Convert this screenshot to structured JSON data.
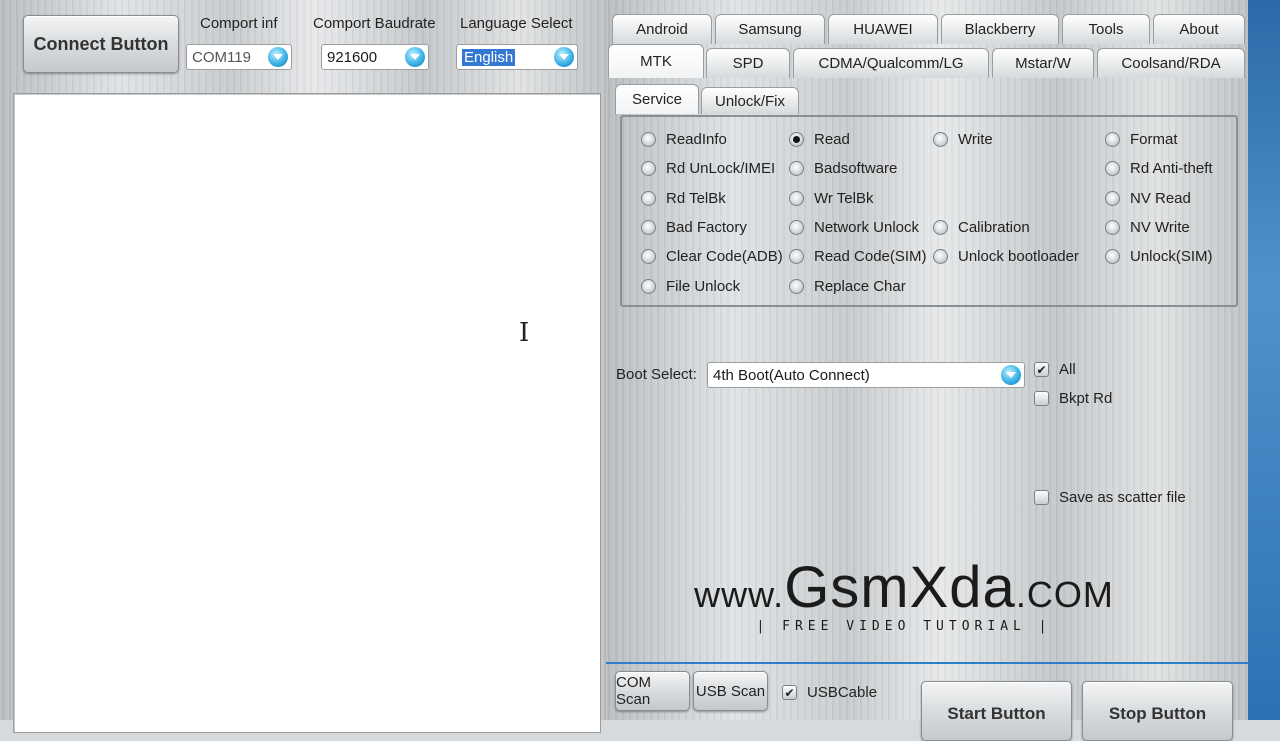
{
  "top": {
    "connect_label": "Connect Button",
    "comport_label": "Comport inf",
    "comport_value": "COM119",
    "baud_label": "Comport Baudrate",
    "baud_value": "921600",
    "lang_label": "Language Select",
    "lang_value": "English"
  },
  "brand_tabs": [
    "Android",
    "Samsung",
    "HUAWEI",
    "Blackberry",
    "Tools",
    "About"
  ],
  "chip_tabs": [
    "MTK",
    "SPD",
    "CDMA/Qualcomm/LG",
    "Mstar/W",
    "Coolsand/RDA"
  ],
  "sub_tabs": [
    "Service",
    "Unlock/Fix"
  ],
  "service": {
    "col1": [
      "ReadInfo",
      "Rd UnLock/IMEI",
      "Rd TelBk",
      "Bad Factory",
      "Clear Code(ADB)",
      "File Unlock"
    ],
    "col2": [
      "Read",
      "Badsoftware",
      "Wr TelBk",
      "Network Unlock",
      "Read Code(SIM)",
      "Replace Char"
    ],
    "col3": [
      "Write",
      "Calibration",
      "Unlock bootloader"
    ],
    "col4": [
      "Format",
      "Rd Anti-theft",
      "NV Read",
      "NV Write",
      "Unlock(SIM)"
    ],
    "selected": "Read"
  },
  "boot": {
    "label": "Boot Select:",
    "value": "4th Boot(Auto Connect)",
    "all_label": "All",
    "all_checked": true,
    "bkpt_label": "Bkpt Rd",
    "bkpt_checked": false,
    "scatter_label": "Save as scatter file",
    "scatter_checked": false
  },
  "watermark": {
    "prefix": "www.",
    "name": "GsmXda",
    "suffix": ".com",
    "sub": "| FREE VIDEO TUTORIAL |"
  },
  "bottom": {
    "com_scan": "COM Scan",
    "usb_scan": "USB Scan",
    "usb_cable": "USBCable",
    "usb_cable_checked": true,
    "start": "Start Button",
    "stop": "Stop Button"
  },
  "colors": {
    "accent_blue": "#2e7fc9",
    "selection": "#3478d1"
  }
}
